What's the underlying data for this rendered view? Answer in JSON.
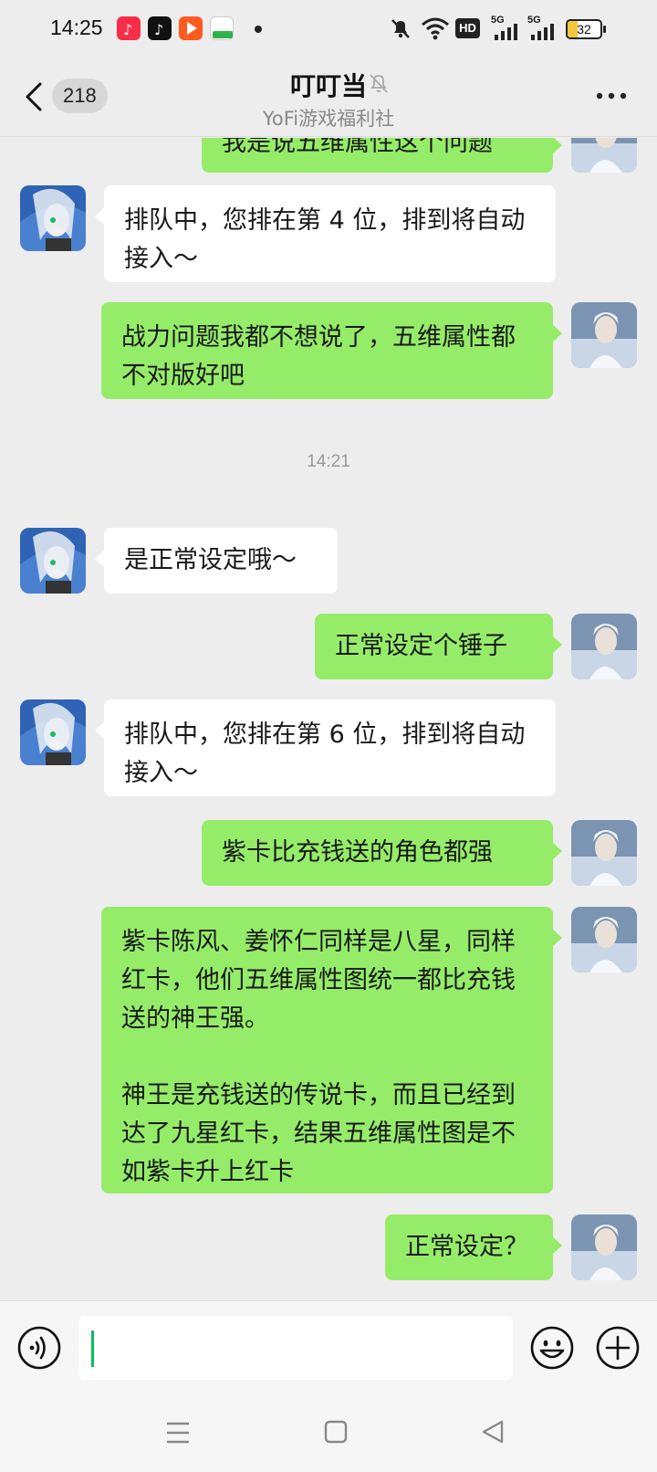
{
  "status_bar": {
    "time": "14:25",
    "battery": "32",
    "hd_label": "HD",
    "signal1": "5G",
    "signal2": "5G"
  },
  "header": {
    "back_count": "218",
    "title": "叮叮当",
    "subtitle": "YoFi游戏福利社"
  },
  "messages": [
    {
      "side": "out",
      "text": "我是说五维属性这个问题"
    },
    {
      "side": "in",
      "text": "排队中，您排在第 4 位，排到将自动接入～"
    },
    {
      "side": "out",
      "text": "战力问题我都不想说了，五维属性都不对版好吧"
    },
    {
      "timestamp": "14:21"
    },
    {
      "side": "in",
      "text": "是正常设定哦～"
    },
    {
      "side": "out",
      "text": "正常设定个锤子"
    },
    {
      "side": "in",
      "text": "排队中，您排在第 6 位，排到将自动接入～"
    },
    {
      "side": "out",
      "text": "紫卡比充钱送的角色都强"
    },
    {
      "side": "out",
      "text": "紫卡陈风、姜怀仁同样是八星，同样红卡，他们五维属性图统一都比充钱送的神王强。\n\n神王是充钱送的传说卡，而且已经到达了九星红卡，结果五维属性图是不如紫卡升上红卡"
    },
    {
      "side": "out",
      "text": "正常设定？"
    }
  ],
  "input": {
    "value": ""
  },
  "colors": {
    "outgoing_bubble": "#95ec69",
    "incoming_bubble": "#ffffff",
    "background": "#ededed",
    "accent": "#07c160"
  },
  "icons": {
    "back": "chevron-left-icon",
    "mute": "bell-off-icon",
    "more": "more-dots-icon",
    "voice": "voice-icon",
    "emoji": "emoji-icon",
    "plus": "plus-icon"
  }
}
